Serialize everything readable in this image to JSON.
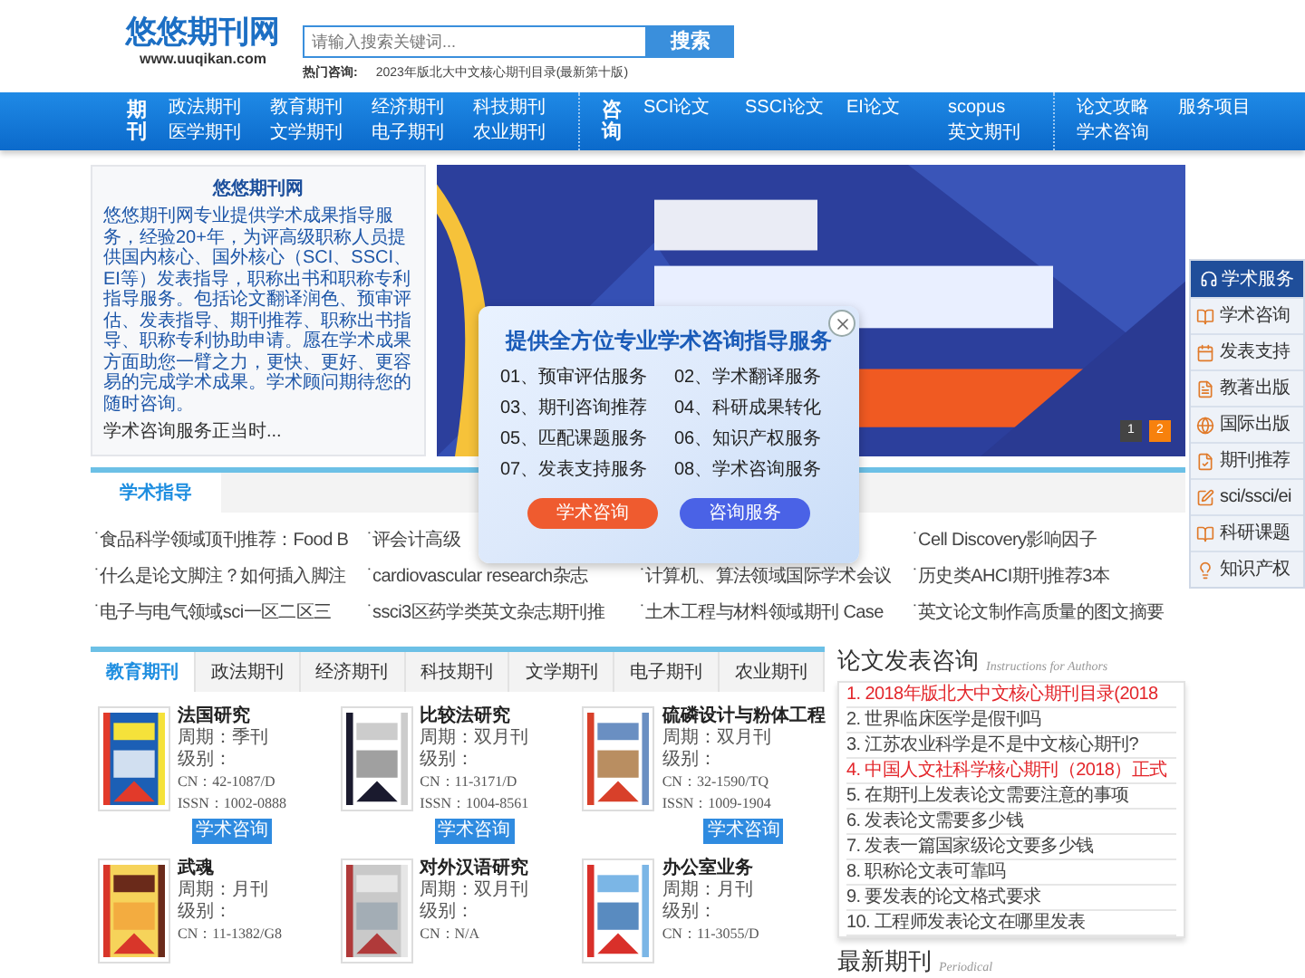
{
  "header": {
    "logo": "悠悠期刊网",
    "site": "www.uuqikan.com",
    "search": {
      "placeholder": "请输入搜索关键词...",
      "button": "搜索"
    },
    "hot": {
      "label": "热门咨询:",
      "link": "2023年版北大中文核心期刊目录(最新第十版)"
    }
  },
  "nav": {
    "groups": [
      {
        "badge": "期刊",
        "columns": [
          [
            "政法期刊",
            "医学期刊"
          ],
          [
            "教育期刊",
            "文学期刊"
          ],
          [
            "经济期刊",
            "电子期刊"
          ],
          [
            "科技期刊",
            "农业期刊"
          ]
        ]
      },
      {
        "badge": "咨询",
        "columns": [
          [
            "SCI论文"
          ],
          [
            "SSCI论文"
          ],
          [
            "EI论文"
          ],
          [
            "scopus",
            "英文期刊"
          ]
        ]
      },
      {
        "columns": [
          [
            "论文攻略",
            "学术咨询"
          ],
          [
            "服务项目"
          ]
        ]
      }
    ]
  },
  "intro": {
    "title": "悠悠期刊网",
    "text": "悠悠期刊网专业提供学术成果指导服务，经验20+年，为评高级职称人员提供国内核心、国外核心（SCI、SSCI、EI等）发表指导，职称出书和职称专利指导服务。包括论文翻译润色、预审评估、发表指导、期刊推荐、职称出书指导、职称专利协助申请。愿在学术成果方面助您一臂之力，更快、更好、更容易的完成学术成果。学术顾问期待您的随时咨询。",
    "footer": "学术咨询服务正当时..."
  },
  "banner": {
    "kind": "picture",
    "pages": [
      {
        "label": "1",
        "selected": false
      },
      {
        "label": "2",
        "selected": true
      }
    ]
  },
  "popup": {
    "title": "提供全方位专业学术咨询指导服务",
    "services": [
      "01、预审评估服务",
      "02、学术翻译服务",
      "03、期刊咨询推荐",
      "04、科研成果转化",
      "05、匹配课题服务",
      "06、知识产权服务",
      "07、发表支持服务",
      "08、学术咨询服务"
    ],
    "buttons": [
      {
        "label": "学术咨询",
        "kind": "warm"
      },
      {
        "label": "咨询服务",
        "kind": "cool"
      }
    ]
  },
  "side_menu": {
    "title": "学术服务",
    "items": [
      "学术咨询",
      "发表支持",
      "教著出版",
      "国际出版",
      "期刊推荐",
      "sci/ssci/ei",
      "科研课题",
      "知识产权"
    ]
  },
  "guide": {
    "bullet": "˙",
    "tabs": [
      {
        "label": "学术指导",
        "selected": true
      }
    ],
    "columns": [
      [
        "食品科学领域顶刊推荐：Food B",
        "什么是论文脚注？如何插入脚注",
        "电子与电气领域sci一区二区三"
      ],
      [
        "评会计高级",
        "cardiovascular research杂志",
        "ssci3区药学类英文杂志期刊推"
      ],
      [
        "计算机、算法领域国际学术会议",
        "土木工程与材料领域期刊 Case"
      ],
      [
        "Cell Discovery影响因子",
        "历史类AHCI期刊推荐3本",
        "英文论文制作高质量的图文摘要"
      ]
    ]
  },
  "journals": {
    "tabs": [
      {
        "label": "教育期刊",
        "selected": true
      },
      {
        "label": "政法期刊",
        "selected": false
      },
      {
        "label": "经济期刊",
        "selected": false
      },
      {
        "label": "科技期刊",
        "selected": false
      },
      {
        "label": "文学期刊",
        "selected": false
      },
      {
        "label": "电子期刊",
        "selected": false
      },
      {
        "label": "农业期刊",
        "selected": false
      }
    ],
    "items": [
      {
        "name": "法国研究",
        "period": "周期：季刊",
        "level": "级别：",
        "cn": "CN：42-1087/D",
        "issn": "ISSN：1002-0888",
        "button": "学术咨询"
      },
      {
        "name": "比较法研究",
        "period": "周期：双月刊",
        "level": "级别：",
        "cn": "CN：11-3171/D",
        "issn": "ISSN：1004-8561",
        "button": "学术咨询"
      },
      {
        "name": "硫磷设计与粉体工程",
        "period": "周期：双月刊",
        "level": "级别：",
        "cn": "CN：32-1590/TQ",
        "issn": "ISSN：1009-1904",
        "button": "学术咨询"
      },
      {
        "name": "武魂",
        "period": "周期：月刊",
        "level": "级别：",
        "cn": "CN：11-1382/G8"
      },
      {
        "name": "对外汉语研究",
        "period": "周期：双月刊",
        "level": "级别：",
        "cn": "CN：N/A"
      },
      {
        "name": "办公室业务",
        "period": "周期：月刊",
        "level": "级别：",
        "cn": "CN：11-3055/D"
      }
    ]
  },
  "articles": {
    "title": "论文发表咨询",
    "subtitle": "Instructions for Authors",
    "items": [
      {
        "text": "1. 2018年版北大中文核心期刊目录(2018",
        "highlight": true
      },
      {
        "text": "2. 世界临床医学是假刊吗",
        "highlight": false
      },
      {
        "text": "3. 江苏农业科学是不是中文核心期刊?",
        "highlight": false
      },
      {
        "text": "4. 中国人文社科学核心期刊（2018）正式",
        "highlight": true
      },
      {
        "text": "5. 在期刊上发表论文需要注意的事项",
        "highlight": false
      },
      {
        "text": "6. 发表论文需要多少钱",
        "highlight": false
      },
      {
        "text": "7. 发表一篇国家级论文要多少钱",
        "highlight": false
      },
      {
        "text": "8. 职称论文表可靠吗",
        "highlight": false
      },
      {
        "text": "9. 要发表的论文格式要求",
        "highlight": false
      },
      {
        "text": "10. 工程师发表论文在哪里发表",
        "highlight": false
      }
    ]
  },
  "latest": {
    "title": "最新期刊",
    "subtitle": "Periodical"
  }
}
